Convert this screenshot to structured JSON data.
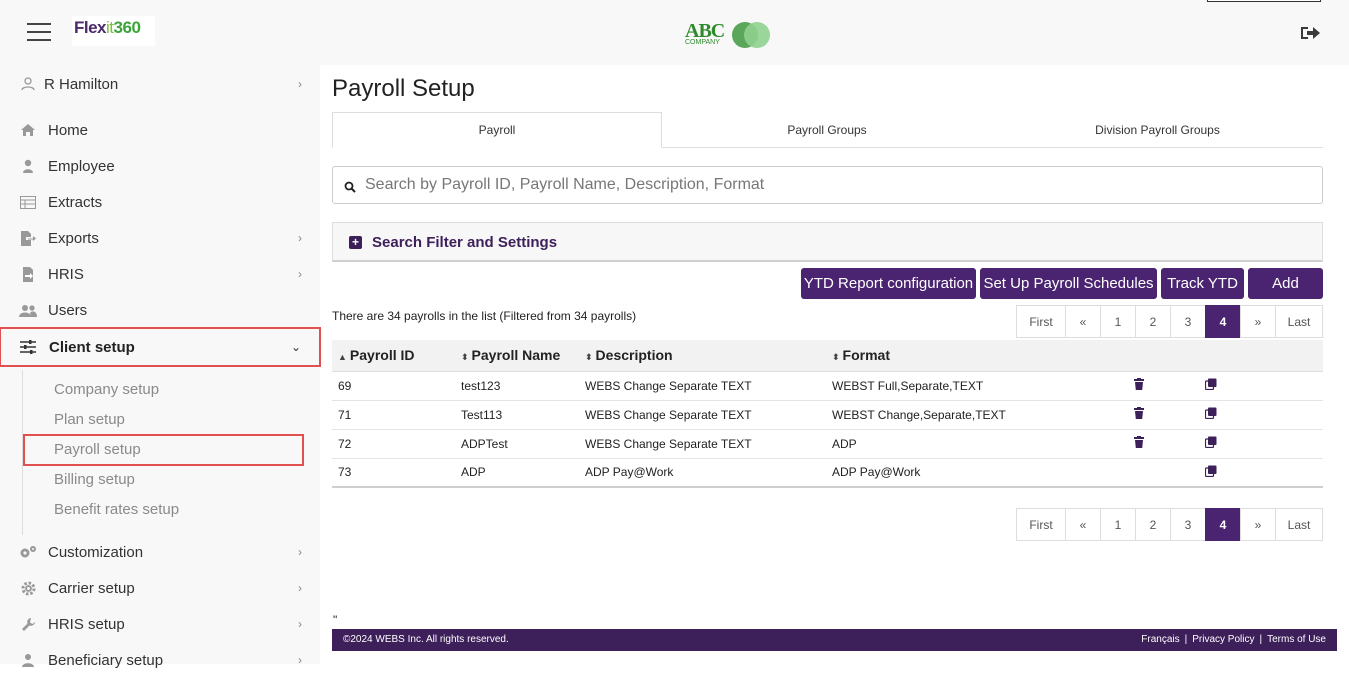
{
  "header": {
    "brand_part1": "Flex",
    "brand_part2": "it",
    "brand_part3": "360",
    "client_logo_main": "ABC",
    "client_logo_sub": "COMPANY"
  },
  "sidebar": {
    "user_name": "R Hamilton",
    "items": [
      {
        "label": "Home",
        "icon": "home-icon"
      },
      {
        "label": "Employee",
        "icon": "person-icon"
      },
      {
        "label": "Extracts",
        "icon": "table-icon"
      },
      {
        "label": "Exports",
        "icon": "export-icon"
      },
      {
        "label": "HRIS",
        "icon": "hris-icon"
      },
      {
        "label": "Users",
        "icon": "users-icon"
      },
      {
        "label": "Client setup",
        "icon": "sliders-icon"
      },
      {
        "label": "Customization",
        "icon": "gears-icon"
      },
      {
        "label": "Carrier setup",
        "icon": "cog-icon"
      },
      {
        "label": "HRIS setup",
        "icon": "wrench-icon"
      },
      {
        "label": "Beneficiary setup",
        "icon": "beneficiary-icon"
      }
    ],
    "client_setup_sub": [
      "Company setup",
      "Plan setup",
      "Payroll setup",
      "Billing setup",
      "Benefit rates setup"
    ]
  },
  "main": {
    "title": "Payroll Setup",
    "tabs": [
      "Payroll",
      "Payroll Groups",
      "Division Payroll Groups"
    ],
    "search_placeholder": "Search by Payroll ID, Payroll Name, Description, Format",
    "filter_label": "Search Filter and Settings",
    "buttons": {
      "ytd_report": "YTD Report configuration",
      "payroll_schedules": "Set Up Payroll Schedules",
      "track_ytd": "Track YTD",
      "add": "Add"
    },
    "count_text": "There are 34 payrolls in the list (Filtered from 34 payrolls)",
    "pager": {
      "first": "First",
      "prev": "«",
      "pages": [
        "1",
        "2",
        "3",
        "4"
      ],
      "current": "4",
      "next": "»",
      "last": "Last"
    },
    "columns": [
      "Payroll ID",
      "Payroll Name",
      "Description",
      "Format"
    ],
    "rows": [
      {
        "id": "69",
        "name": "test123",
        "description": "WEBS Change Separate TEXT",
        "format": "WEBST Full,Separate,TEXT",
        "delete": true
      },
      {
        "id": "71",
        "name": "Test113",
        "description": "WEBS Change Separate TEXT",
        "format": "WEBST Change,Separate,TEXT",
        "delete": true
      },
      {
        "id": "72",
        "name": "ADPTest",
        "description": "WEBS Change Separate TEXT",
        "format": "ADP",
        "delete": true
      },
      {
        "id": "73",
        "name": "ADP",
        "description": "ADP Pay@Work",
        "format": "ADP Pay@Work",
        "delete": false
      }
    ],
    "stray_text": "\""
  },
  "footer": {
    "copyright": "©2024 WEBS Inc. All rights reserved.",
    "links": [
      "Français",
      "Privacy Policy",
      "Terms of Use"
    ],
    "separator": "|"
  },
  "colors": {
    "primary": "#4a2470",
    "footer_bg": "#3d1f5a",
    "highlight_border": "#e05050",
    "sidebar_bg": "#f8f8f8"
  }
}
